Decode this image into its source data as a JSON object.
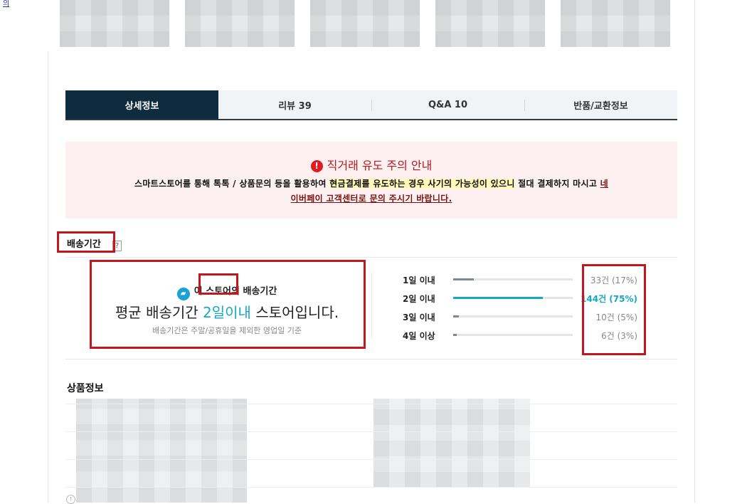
{
  "top_link": "의",
  "tabs": [
    {
      "label": "상세정보",
      "active": true
    },
    {
      "label": "리뷰 39",
      "active": false
    },
    {
      "label": "Q&A 10",
      "active": false
    },
    {
      "label": "반품/교환정보",
      "active": false
    }
  ],
  "notice": {
    "icon": "exclamation-icon",
    "title": "직거래 유도 주의 안내",
    "body_plain": "스마트스토어를 통해 톡톡 / 상품문의 등을 활용하여 ",
    "body_highlight": "현금결제를 유도하는 경우 사기의 가능성이 있으니",
    "body_mid": " 절대 결제하지 마시고 ",
    "body_link1": "네",
    "body_link2": "이버페이 고객센터로 문의 주시기 바랍니다."
  },
  "delivery": {
    "section_title": "배송기간",
    "help": "?",
    "store_icon": "truck-icon",
    "caption": "이 스토어의 배송기간",
    "summary_prefix": "평균 배송기간 ",
    "summary_highlight": "2일이내",
    "summary_suffix": " 스토어입니다.",
    "note": "배송기간은 주말/공휴일을 제외한 영업일 기준",
    "rows": [
      {
        "label": "1일 이내",
        "count": "33건",
        "pct": "(17%)",
        "fraction": 0.17,
        "highlight": false
      },
      {
        "label": "2일 이내",
        "count": "144건",
        "pct": "(75%)",
        "fraction": 0.75,
        "highlight": true
      },
      {
        "label": "3일 이내",
        "count": "10건",
        "pct": "(5%)",
        "fraction": 0.05,
        "highlight": false
      },
      {
        "label": "4일 이상",
        "count": "6건",
        "pct": "(3%)",
        "fraction": 0.03,
        "highlight": false
      }
    ]
  },
  "product_info": {
    "title": "상품정보"
  },
  "colors": {
    "accent": "#12a9c4",
    "tab_active": "#0f2c3f",
    "warning": "#c4161c"
  }
}
